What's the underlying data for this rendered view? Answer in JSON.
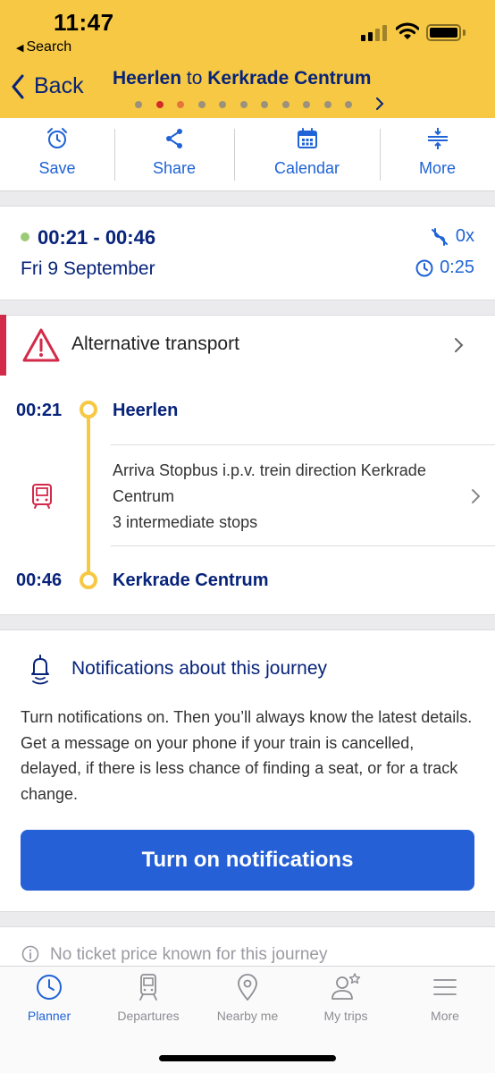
{
  "status_bar": {
    "time": "11:47",
    "back_app": "Search"
  },
  "nav": {
    "back_label": "Back",
    "from": "Heerlen",
    "connector": "to",
    "to": "Kerkrade Centrum",
    "pager_dot_count": 11,
    "pager_active_dot": 1
  },
  "actions": [
    {
      "label": "Save",
      "icon": "alarm-clock-icon"
    },
    {
      "label": "Share",
      "icon": "share-icon"
    },
    {
      "label": "Calendar",
      "icon": "calendar-icon"
    },
    {
      "label": "More",
      "icon": "expand-icon"
    }
  ],
  "trip": {
    "time_range": "00:21 - 00:46",
    "date": "Fri 9 September",
    "transfers": "0x",
    "duration": "0:25"
  },
  "journey": {
    "alert": "Alternative transport",
    "departure": {
      "time": "00:21",
      "station": "Heerlen"
    },
    "leg": {
      "line1": "Arriva Stopbus i.p.v. trein direction Kerkrade",
      "line2": "Centrum",
      "line3": "3 intermediate stops"
    },
    "arrival": {
      "time": "00:46",
      "station": "Kerkrade Centrum"
    }
  },
  "notifications": {
    "title": "Notifications about this journey",
    "body": "Turn notifications on. Then you’ll always know the latest details. Get a message on your phone if your train is cancelled, delayed, if there is less chance of finding a seat, or for a track change.",
    "button": "Turn on notifications"
  },
  "ticket": {
    "text": "No ticket price known for this journey"
  },
  "tabs": [
    {
      "label": "Planner",
      "icon": "clock-icon",
      "active": true
    },
    {
      "label": "Departures",
      "icon": "train-icon",
      "active": false
    },
    {
      "label": "Nearby me",
      "icon": "location-pin-icon",
      "active": false
    },
    {
      "label": "My trips",
      "icon": "person-star-icon",
      "active": false
    },
    {
      "label": "More",
      "icon": "menu-icon",
      "active": false
    }
  ],
  "colors": {
    "header_yellow": "#f6c843",
    "navy": "#07237a",
    "accent_blue": "#1f63d6",
    "alert_red": "#d32a4a",
    "button_blue": "#2560d6"
  }
}
